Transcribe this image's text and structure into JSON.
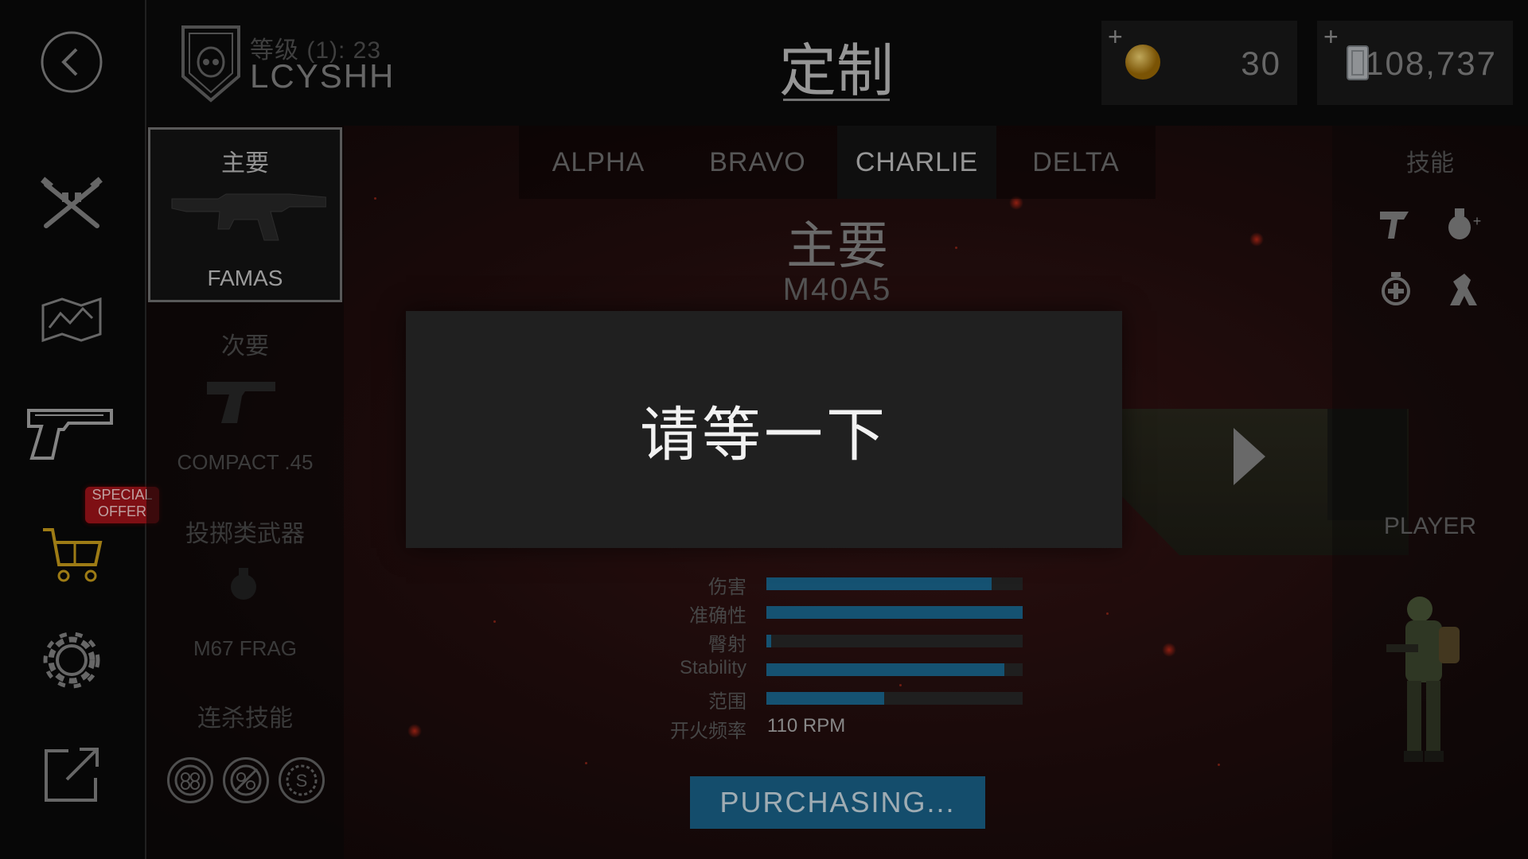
{
  "player": {
    "level_label": "等级 (1): 23",
    "name": "LCYSHH"
  },
  "header": {
    "title": "定制"
  },
  "currency": [
    {
      "name": "gold",
      "plus": "+",
      "value": "30"
    },
    {
      "name": "cash",
      "plus": "+",
      "value": "108,737"
    }
  ],
  "sidebar": {
    "special_offer": "SPECIAL OFFER"
  },
  "loadout": {
    "primary_label": "主要",
    "primary_weapon": "FAMAS",
    "secondary_label": "次要",
    "secondary_weapon": "COMPACT .45",
    "throwable_label": "投掷类武器",
    "throwable_weapon": "M67 FRAG",
    "killstreak_label": "连杀技能"
  },
  "tabs": [
    "ALPHA",
    "BRAVO",
    "CHARLIE",
    "DELTA"
  ],
  "active_tab": "CHARLIE",
  "section": {
    "title": "主要",
    "weapon": "M40A5"
  },
  "skills": {
    "title": "技能",
    "player_label": "PLAYER"
  },
  "modal": {
    "text": "请等一下"
  },
  "stats": [
    {
      "label": "伤害",
      "value": 0.88
    },
    {
      "label": "准确性",
      "value": 1.0
    },
    {
      "label": "臀射",
      "value": 0.02
    },
    {
      "label": "Stability",
      "value": 0.93
    },
    {
      "label": "范围",
      "value": 0.46
    }
  ],
  "rate_of_fire": {
    "label": "开火频率",
    "value": "110 RPM"
  },
  "purchase_button": "PURCHASING..."
}
